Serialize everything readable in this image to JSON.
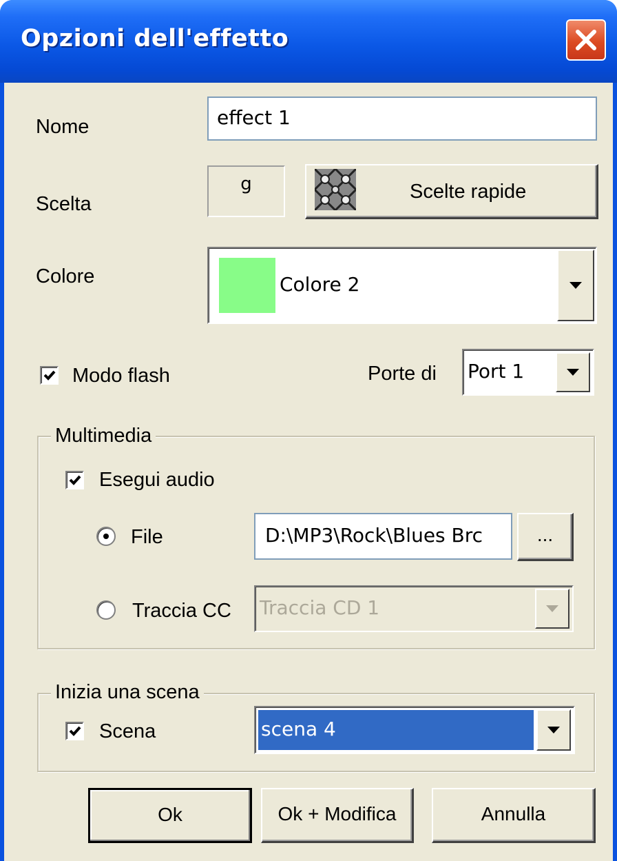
{
  "window": {
    "title": "Opzioni dell'effetto",
    "close_icon": "close-icon"
  },
  "name": {
    "label": "Nome",
    "value": "effect 1"
  },
  "shortcut": {
    "label": "Scelta",
    "value": "g",
    "quick_button_label": "Scelte rapide",
    "quick_icon": "dice-pattern-icon"
  },
  "color": {
    "label": "Colore",
    "selected": "Colore 2",
    "swatch": "#88fc88"
  },
  "flash": {
    "label": "Modo flash",
    "checked": true
  },
  "port": {
    "label": "Porte di",
    "selected": "Port 1"
  },
  "multimedia": {
    "legend": "Multimedia",
    "play_audio_label": "Esegui audio",
    "play_audio_checked": true,
    "file_label": "File",
    "file_path": "D:\\MP3\\Rock\\Blues Brc",
    "browse_label": "...",
    "cd_label": "Traccia CC",
    "cd_selected": "Traccia CD 1"
  },
  "scene": {
    "legend": "Inizia una scena",
    "scene_label": "Scena",
    "scene_checked": true,
    "selected": "scena 4",
    "highlight": "#316ac5"
  },
  "buttons": {
    "ok": "Ok",
    "ok_edit": "Ok + Modifica",
    "cancel": "Annulla"
  },
  "colors": {
    "titlebar": "#0549d4",
    "dialog_bg": "#ece9d8",
    "close_button": "#dc4b22"
  }
}
